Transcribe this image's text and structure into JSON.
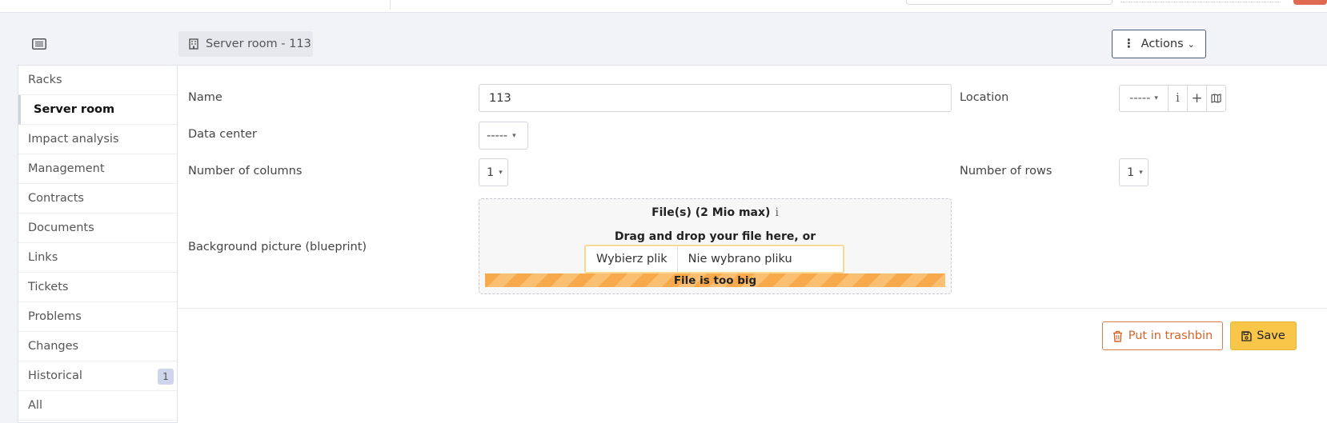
{
  "header": {
    "breadcrumb": "Server room - 113",
    "actions_label": "Actions",
    "actions_dots": "⋮",
    "actions_chevron": "⌄"
  },
  "sidebar": {
    "items": [
      {
        "label": "Racks"
      },
      {
        "label": "Server room"
      },
      {
        "label": "Impact analysis"
      },
      {
        "label": "Management"
      },
      {
        "label": "Contracts"
      },
      {
        "label": "Documents"
      },
      {
        "label": "Links"
      },
      {
        "label": "Tickets"
      },
      {
        "label": "Problems"
      },
      {
        "label": "Changes"
      },
      {
        "label": "Historical",
        "badge": "1"
      },
      {
        "label": "All"
      }
    ],
    "active": "Server room"
  },
  "form": {
    "name_label": "Name",
    "name_value": "113",
    "location_label": "Location",
    "location_value": "-----",
    "location_info": "i",
    "location_add": "+",
    "datacenter_label": "Data center",
    "datacenter_value": "-----",
    "columns_label": "Number of columns",
    "columns_value": "1",
    "rows_label": "Number of rows",
    "rows_value": "1",
    "background_label": "Background picture (blueprint)",
    "caret": "▾"
  },
  "upload": {
    "title": "File(s) (2 Mio max)",
    "info": "i",
    "drag_text": "Drag and drop your file here, or",
    "choose_button": "Wybierz plik",
    "no_file_text": "Nie wybrano pliku",
    "error": "File is too big"
  },
  "footer": {
    "trash_label": "Put in trashbin",
    "save_label": "Save"
  },
  "colors": {
    "accent_save": "#f9c64a",
    "trash": "#d9622a",
    "upload_error_bar": "#f7a94c"
  }
}
